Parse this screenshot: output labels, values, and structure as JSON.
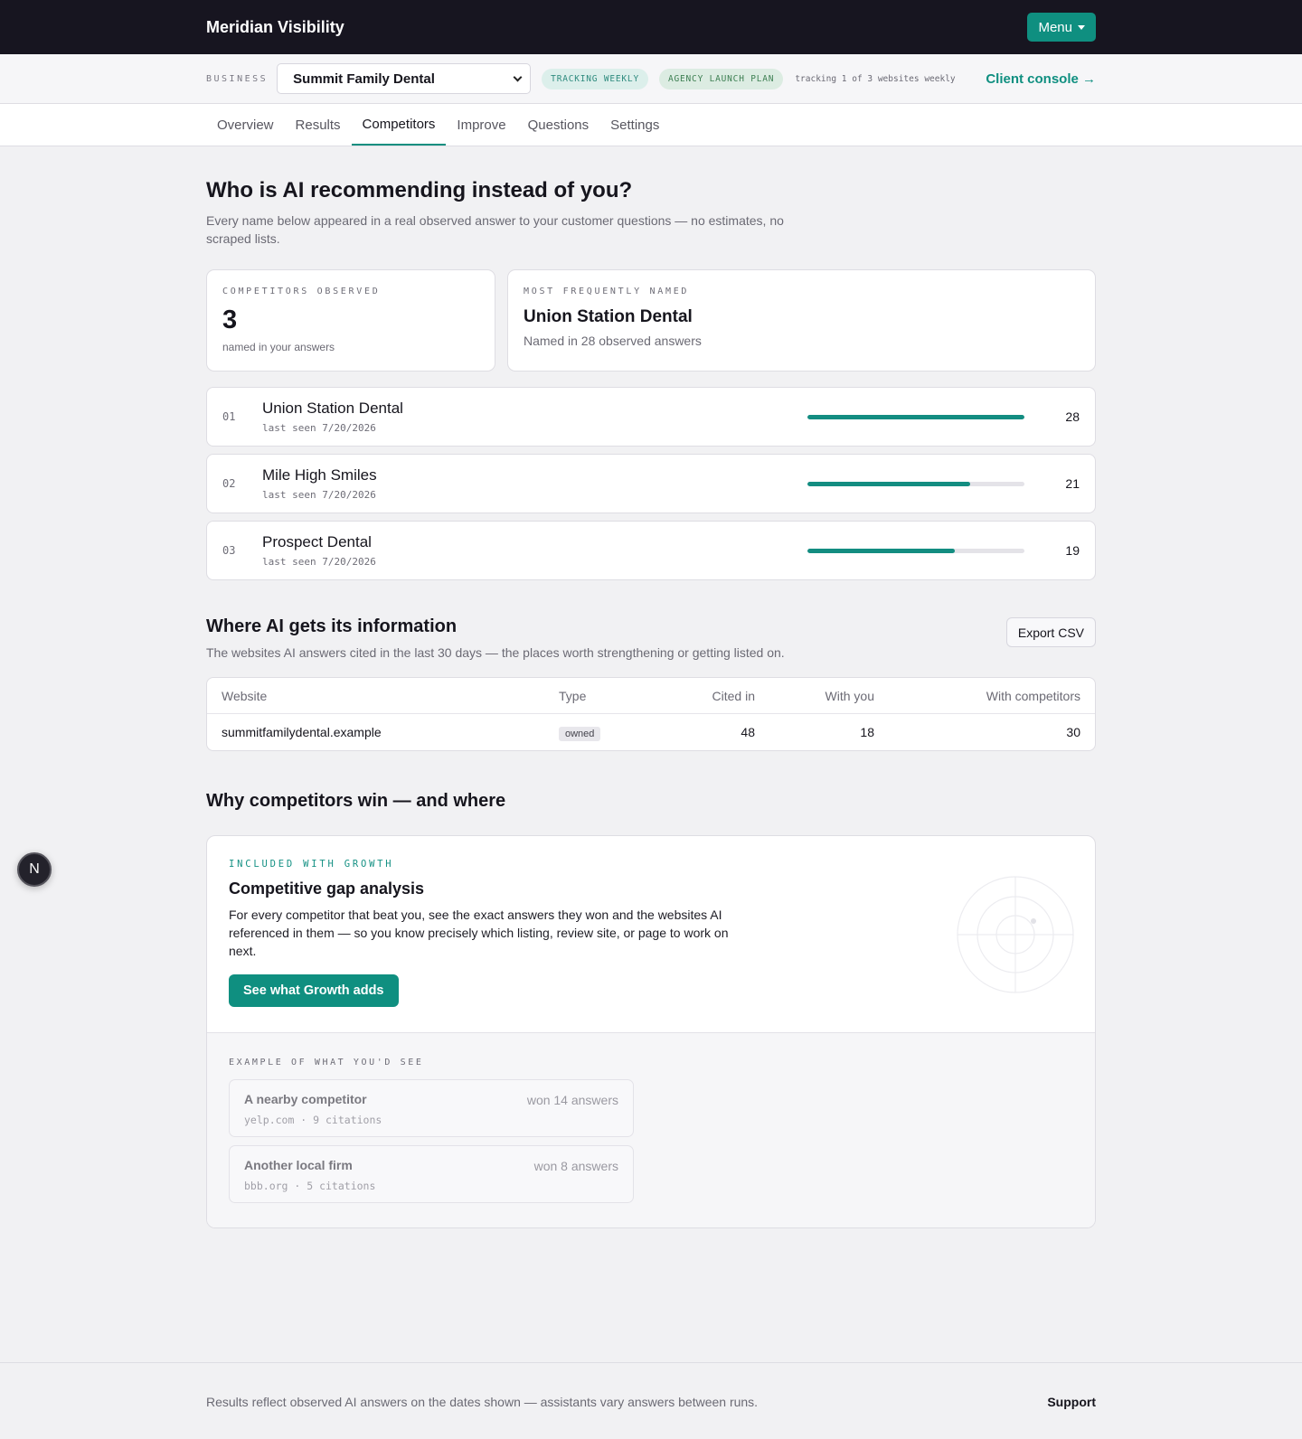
{
  "app": {
    "brand": "Meridian Visibility",
    "menu_label": "Menu"
  },
  "bizbar": {
    "label": "BUSINESS",
    "selected_business": "Summit Family Dental",
    "pill_tracking": "TRACKING WEEKLY",
    "pill_plan": "AGENCY LAUNCH PLAN",
    "tracking_text": "tracking 1 of 3 websites weekly",
    "console_link": "Client console →"
  },
  "tabs": [
    {
      "label": "Overview"
    },
    {
      "label": "Results"
    },
    {
      "label": "Competitors",
      "active": true
    },
    {
      "label": "Improve"
    },
    {
      "label": "Questions"
    },
    {
      "label": "Settings"
    }
  ],
  "competitors": {
    "title": "Who is AI recommending instead of you?",
    "subtitle": "Every name below appeared in a real observed answer to your customer questions — no estimates, no scraped lists.",
    "observed": {
      "kicker": "COMPETITORS OBSERVED",
      "count": "3",
      "note": "named in your answers"
    },
    "most_frequent": {
      "kicker": "MOST FREQUENTLY NAMED",
      "name": "Union Station Dental",
      "note": "Named in 28 observed answers"
    },
    "list": [
      {
        "rank": "01",
        "name": "Union Station Dental",
        "seen": "last seen 7/20/2026",
        "count": "28",
        "share": 1.0
      },
      {
        "rank": "02",
        "name": "Mile High Smiles",
        "seen": "last seen 7/20/2026",
        "count": "21",
        "share": 0.75
      },
      {
        "rank": "03",
        "name": "Prospect Dental",
        "seen": "last seen 7/20/2026",
        "count": "19",
        "share": 0.68
      }
    ]
  },
  "sources": {
    "title": "Where AI gets its information",
    "subtitle": "The websites AI answers cited in the last 30 days — the places worth strengthening or getting listed on.",
    "export_label": "Export CSV",
    "columns": [
      "Website",
      "Type",
      "Cited in",
      "With you",
      "With competitors"
    ],
    "rows": [
      {
        "website": "summitfamilydental.example",
        "type": "owned",
        "cited_in": "48",
        "with_you": "18",
        "with_competitors": "30"
      }
    ]
  },
  "why": {
    "title": "Why competitors win — and where",
    "kicker": "INCLUDED WITH GROWTH",
    "card_title": "Competitive gap analysis",
    "description": "For every competitor that beat you, see the exact answers they won and the websites AI referenced in them — so you know precisely which listing, review site, or page to work on next.",
    "cta": "See what Growth adds",
    "example_kicker": "EXAMPLE OF WHAT YOU'D SEE",
    "examples": [
      {
        "name": "A nearby competitor",
        "won": "won 14 answers",
        "meta": "yelp.com · 9 citations"
      },
      {
        "name": "Another local firm",
        "won": "won 8 answers",
        "meta": "bbb.org · 5 citations"
      }
    ]
  },
  "fab": {
    "letter": "N"
  },
  "footer": {
    "text": "Results reflect observed AI answers on the dates shown — assistants vary answers between runs.",
    "support": "Support"
  },
  "colors": {
    "accent": "#0f8f80",
    "topbar": "#171520",
    "background": "#f1f1f3"
  }
}
